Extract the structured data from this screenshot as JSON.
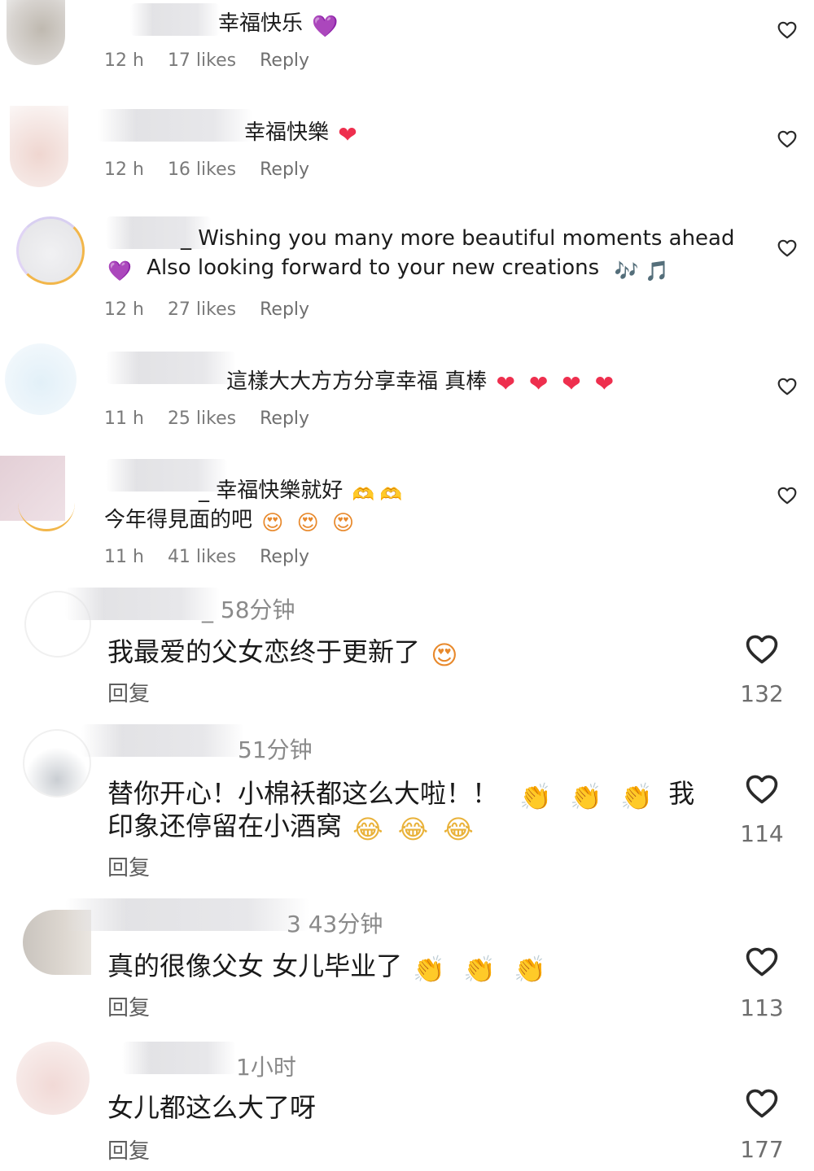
{
  "top_comments": [
    {
      "text": "幸福快乐",
      "emoji": "💜",
      "time": "12 h",
      "likes": "17 likes",
      "reply": "Reply"
    },
    {
      "text": "幸福快樂",
      "emoji": "❤",
      "time": "12 h",
      "likes": "16 likes",
      "reply": "Reply"
    },
    {
      "text_line1": "_ Wishing you many more beautiful moments ahead",
      "text_line2": "Also looking forward to your new creations",
      "emoji_start": "💜",
      "emoji_end": "🎶 🎵",
      "time": "12 h",
      "likes": "27 likes",
      "reply": "Reply"
    },
    {
      "text": "這樣大大方方分享幸福 真棒",
      "emoji": "❤ ❤ ❤ ❤",
      "time": "11 h",
      "likes": "25 likes",
      "reply": "Reply"
    },
    {
      "text_line1": "_ 幸福快樂就好",
      "emoji_line1": "🫶 🫶",
      "text_line2": "今年得見面的吧",
      "emoji_line2": "😍 😍 😍",
      "time": "11 h",
      "likes": "41 likes",
      "reply": "Reply"
    }
  ],
  "cn_comments": [
    {
      "time": "_ 58分钟",
      "text_line1": "我最爱的父女恋终于更新了",
      "emoji_line1": "😍",
      "reply": "回复",
      "like_count": "132"
    },
    {
      "time": "51分钟",
      "text_line1": "替你开心！小棉袄都这么大啦！！",
      "emoji_line1": "👏 👏 👏",
      "text_line1b": "我",
      "text_line2": "印象还停留在小酒窝",
      "emoji_line2": "😂 😂 😂",
      "reply": "回复",
      "like_count": "114"
    },
    {
      "time": "3 43分钟",
      "text_line1": "真的很像父女 女儿毕业了",
      "emoji_line1": "👏 👏 👏",
      "reply": "回复",
      "like_count": "113"
    },
    {
      "time": "1小时",
      "text_line1": "女儿都这么大了呀",
      "reply": "回复",
      "like_count": "177"
    }
  ],
  "icons": {
    "heart": "heart-outline-icon"
  },
  "colors": {
    "red_heart": "#ee2f4e",
    "purple_heart": "#8a3fd1",
    "meta_gray": "#7a7a7a"
  }
}
